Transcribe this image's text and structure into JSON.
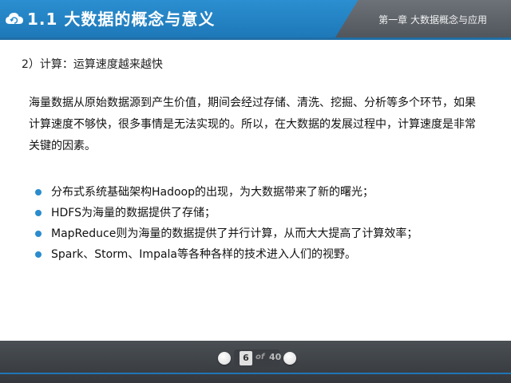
{
  "header": {
    "title": "1.1 大数据的概念与意义",
    "chapter": "第一章 大数据概念与应用"
  },
  "content": {
    "section_heading": "2）计算：运算速度越来越快",
    "paragraph": "海量数据从原始数据源到产生价值，期间会经过存储、清洗、挖掘、分析等多个环节，如果计算速度不够快，很多事情是无法实现的。所以，在大数据的发展过程中，计算速度是非常关键的因素。",
    "bullets": [
      "分布式系统基础架构Hadoop的出现，为大数据带来了新的曙光；",
      "HDFS为海量的数据提供了存储；",
      "MapReduce则为海量的数据提供了并行计算，从而大大提高了计算效率；",
      "Spark、Storm、Impala等各种各样的技术进入人们的视野。"
    ]
  },
  "footer": {
    "current_page": "6",
    "of_label": "of",
    "total_pages": "40"
  },
  "colors": {
    "header_blue": "#2b8fd0",
    "header_gray": "#5e6469",
    "bullet": "#2a8ccc",
    "footer": "#3f4448"
  },
  "icons": {
    "title_icon": "cloud-refresh-icon"
  }
}
